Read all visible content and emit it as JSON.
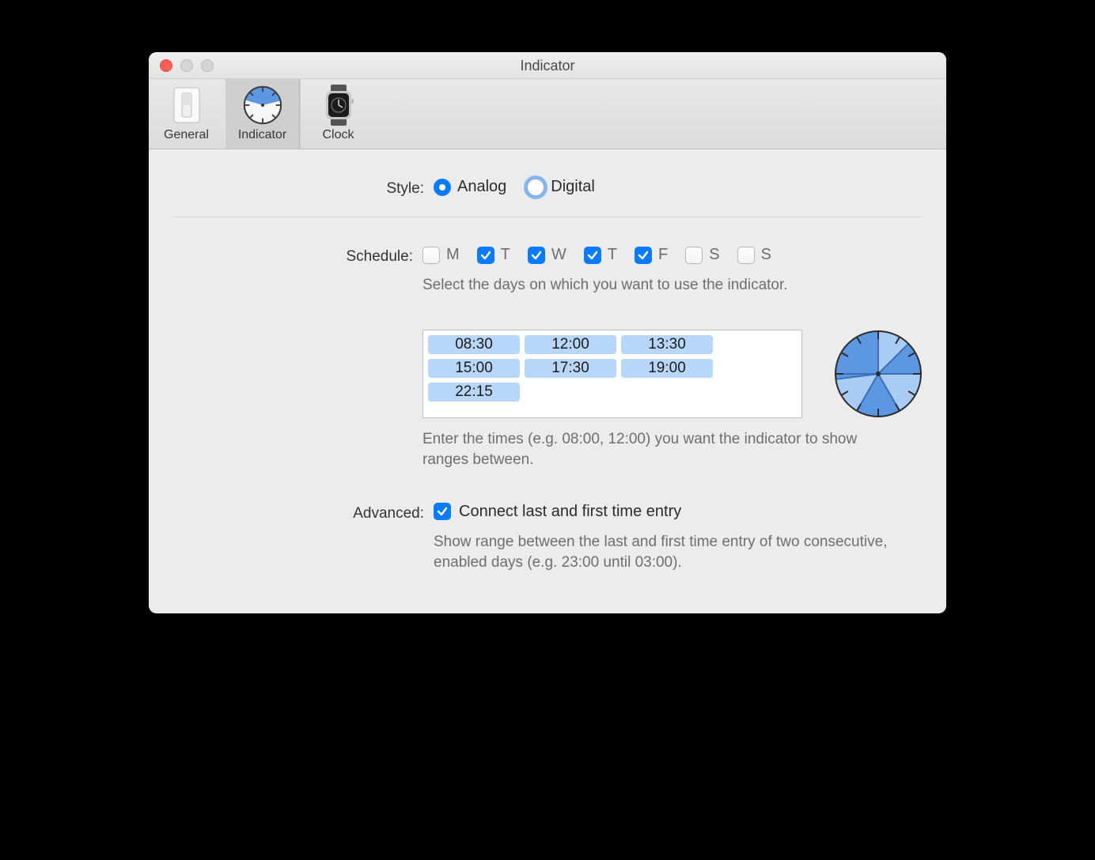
{
  "window": {
    "title": "Indicator"
  },
  "tabs": [
    {
      "id": "general",
      "label": "General",
      "selected": false
    },
    {
      "id": "indicator",
      "label": "Indicator",
      "selected": true
    },
    {
      "id": "clock",
      "label": "Clock",
      "selected": false
    }
  ],
  "style": {
    "label": "Style:",
    "options": [
      {
        "id": "analog",
        "label": "Analog",
        "selected": true,
        "focused": false
      },
      {
        "id": "digital",
        "label": "Digital",
        "selected": false,
        "focused": true
      }
    ]
  },
  "schedule": {
    "label": "Schedule:",
    "help": "Select the days on which you want to use the indicator.",
    "days": [
      {
        "id": "mon",
        "label": "M",
        "checked": false
      },
      {
        "id": "tue",
        "label": "T",
        "checked": true
      },
      {
        "id": "wed",
        "label": "W",
        "checked": true
      },
      {
        "id": "thu",
        "label": "T",
        "checked": true
      },
      {
        "id": "fri",
        "label": "F",
        "checked": true
      },
      {
        "id": "sat",
        "label": "S",
        "checked": false
      },
      {
        "id": "sun",
        "label": "S",
        "checked": false
      }
    ],
    "times": [
      "08:30",
      "12:00",
      "13:30",
      "15:00",
      "17:30",
      "19:00",
      "22:15"
    ],
    "times_help": "Enter the times (e.g. 08:00, 12:00) you want the indicator to show ranges between."
  },
  "advanced": {
    "label": "Advanced:",
    "connect": {
      "checked": true,
      "label": "Connect last and first time entry"
    },
    "help": "Show range between the last and first time entry of two consecutive, enabled days (e.g. 23:00 until 03:00)."
  },
  "colors": {
    "accent": "#0a7aff",
    "token_bg": "#b8d6f8",
    "wedge_light": "#a9ccf5",
    "wedge_dark": "#5d97e2"
  }
}
